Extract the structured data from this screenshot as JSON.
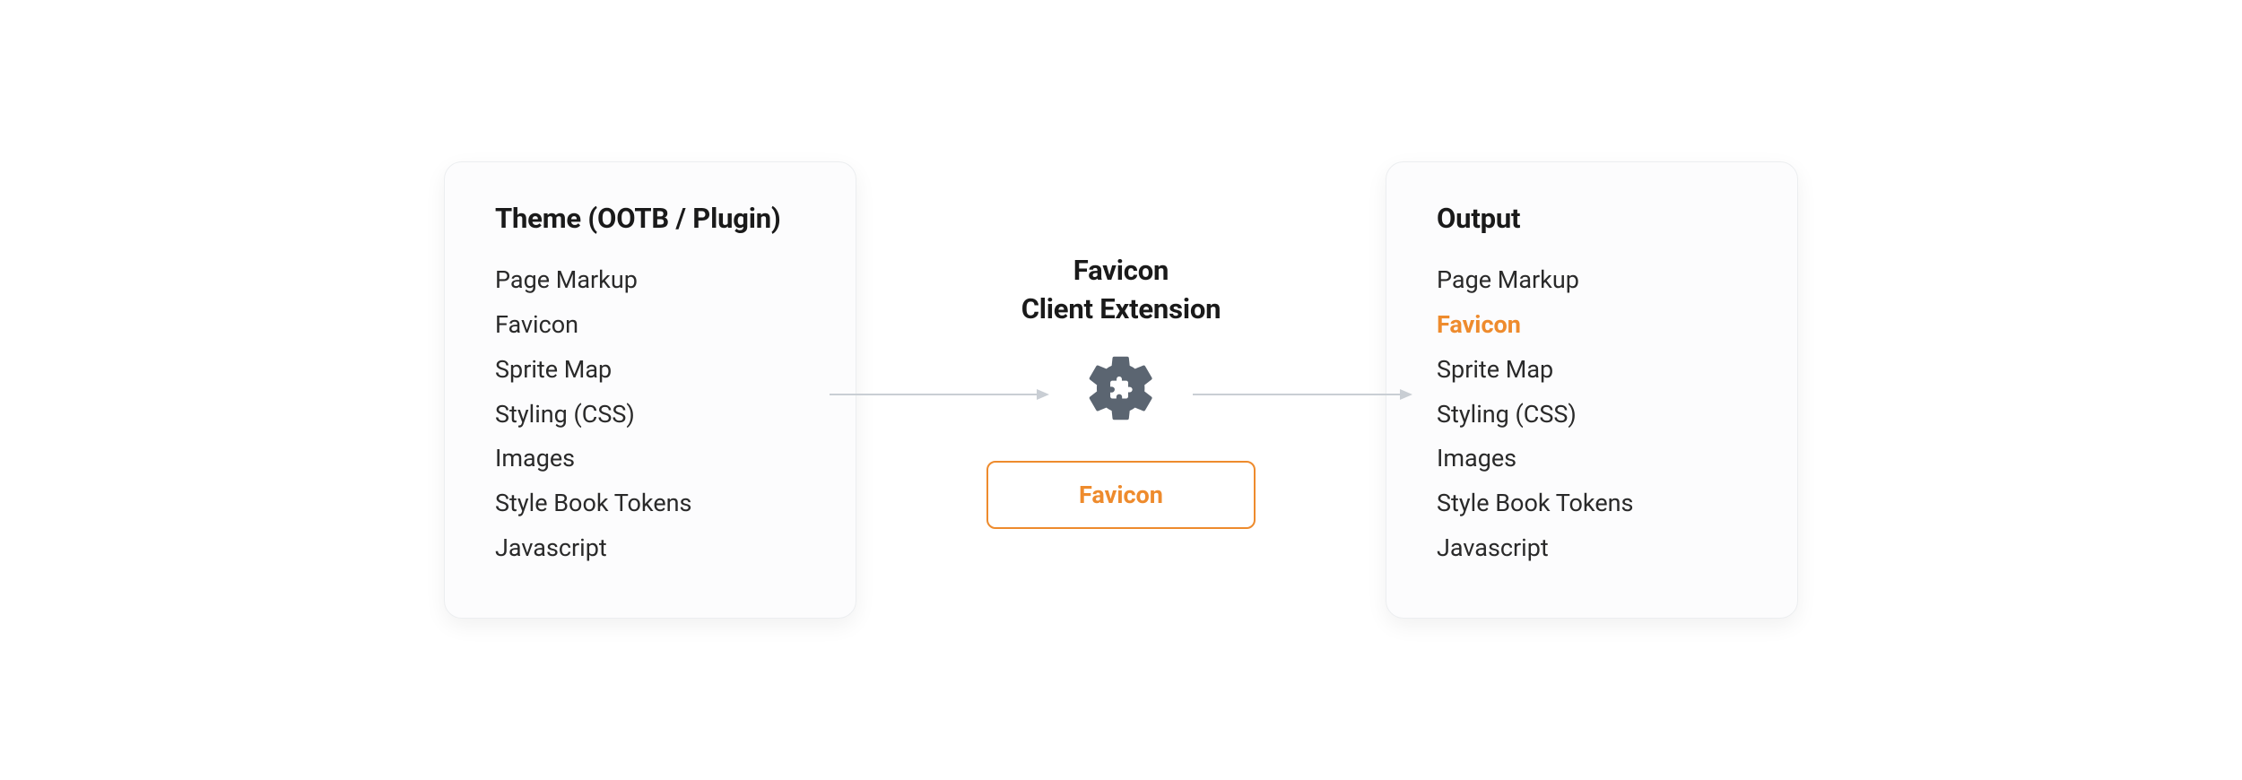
{
  "colors": {
    "accent": "#ee8b2d",
    "gear": "#5b6571",
    "arrow": "#c9ced4",
    "text": "#1a1a1a"
  },
  "left_card": {
    "title": "Theme (OOTB / Plugin)",
    "items": [
      {
        "label": "Page Markup",
        "highlight": false
      },
      {
        "label": "Favicon",
        "highlight": false
      },
      {
        "label": "Sprite Map",
        "highlight": false
      },
      {
        "label": "Styling (CSS)",
        "highlight": false
      },
      {
        "label": "Images",
        "highlight": false
      },
      {
        "label": "Style Book Tokens",
        "highlight": false
      },
      {
        "label": "Javascript",
        "highlight": false
      }
    ]
  },
  "middle": {
    "title_line1": "Favicon",
    "title_line2": "Client Extension",
    "icon": "gear-puzzle-icon",
    "badge_label": "Favicon"
  },
  "right_card": {
    "title": "Output",
    "items": [
      {
        "label": "Page Markup",
        "highlight": false
      },
      {
        "label": "Favicon",
        "highlight": true
      },
      {
        "label": "Sprite Map",
        "highlight": false
      },
      {
        "label": "Styling (CSS)",
        "highlight": false
      },
      {
        "label": "Images",
        "highlight": false
      },
      {
        "label": "Style Book Tokens",
        "highlight": false
      },
      {
        "label": "Javascript",
        "highlight": false
      }
    ]
  }
}
